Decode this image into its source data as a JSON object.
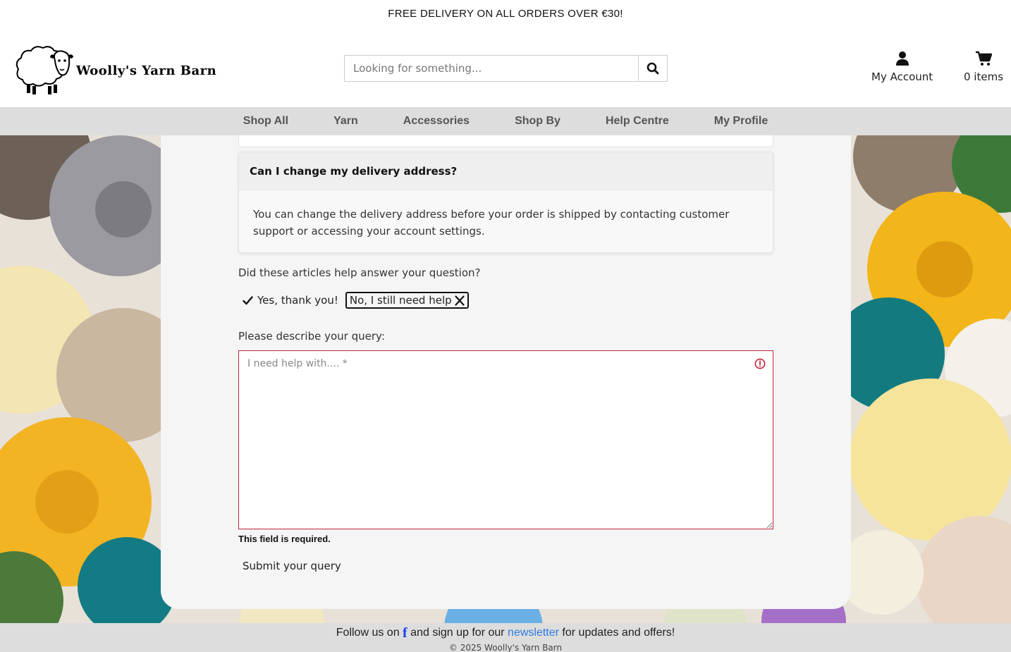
{
  "promo": {
    "text": "FREE DELIVERY ON ALL ORDERS OVER €30!"
  },
  "brand": {
    "name": "Woolly's Yarn Barn"
  },
  "search": {
    "placeholder": "Looking for something..."
  },
  "account": {
    "label": "My Account",
    "cart_label": "0 items"
  },
  "nav": {
    "items": [
      "Shop All",
      "Yarn",
      "Accessories",
      "Shop By",
      "Help Centre",
      "My Profile"
    ]
  },
  "faq": {
    "question": "Can I change my delivery address?",
    "answer": "You can change the delivery address before your order is shipped by contacting customer support or accessing your account settings."
  },
  "feedback": {
    "question": "Did these articles help answer your question?",
    "yes_label": "Yes, thank you!",
    "no_label": "No, I still need help"
  },
  "query": {
    "label": "Please describe your query:",
    "placeholder": "I need help with.... *",
    "value": "",
    "error": "This field is required.",
    "submit_label": "Submit your query"
  },
  "footer": {
    "follow_pre": "Follow us on",
    "follow_mid": "and sign up for our",
    "newsletter_link": "newsletter",
    "follow_post": "for updates and offers!",
    "copyright": "© 2025 Woolly's Yarn Barn"
  },
  "colors": {
    "error": "#c02637",
    "link": "#2d7be0",
    "nav_bg": "#dddddd",
    "panel_bg": "#f5f5f5"
  }
}
